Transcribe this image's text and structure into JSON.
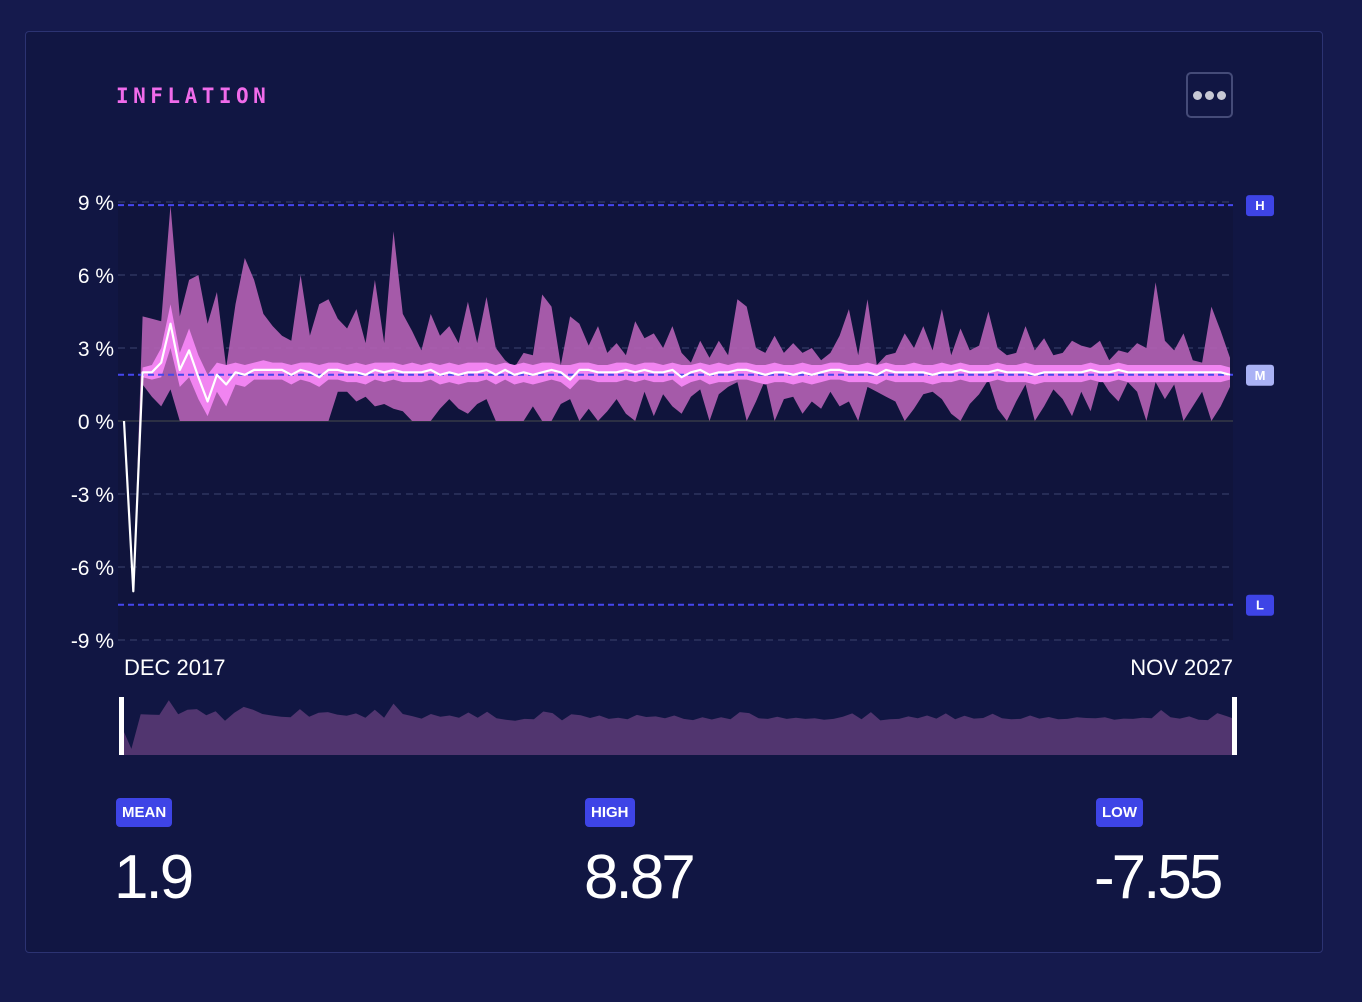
{
  "title": "INFLATION",
  "menu_icon": "ellipsis-icon",
  "colors": {
    "background": "#151a4d",
    "card": "#111643",
    "title": "#f06bea",
    "band_outer": "#b261b3",
    "band_inner": "#f184f1",
    "line": "#ffffff",
    "reference": "#4447ee",
    "badge": "#3e44e6",
    "navigator_fill": "#51356f"
  },
  "chart_data": {
    "type": "area",
    "yunit": " %",
    "ylim": [
      -9,
      9
    ],
    "yticks": [
      9,
      6,
      3,
      0,
      -3,
      -6,
      -9
    ],
    "ytick_labels": [
      "9 %",
      "6 %",
      "3 %",
      "0 %",
      "-3 %",
      "-6 %",
      "-9 %"
    ],
    "x_start_label": "DEC 2017",
    "x_end_label": "NOV 2027",
    "grid": true,
    "reference_lines": [
      {
        "label": "H",
        "value": 8.87
      },
      {
        "label": "M",
        "value": 1.9
      },
      {
        "label": "L",
        "value": -7.55
      }
    ],
    "series": [
      {
        "name": "mean",
        "values": [
          0,
          -7,
          2,
          2,
          2.4,
          4,
          2.1,
          2.9,
          1.8,
          0.8,
          1.9,
          1.5,
          2,
          1.9,
          2.1,
          2.1,
          2.1,
          2.1,
          1.9,
          2.1,
          2,
          1.8,
          2.1,
          2.1,
          2,
          2,
          1.9,
          2.1,
          2,
          2.1,
          2,
          2,
          2,
          2.1,
          1.9,
          2,
          1.9,
          2,
          2,
          2.1,
          1.9,
          2.1,
          1.9,
          2,
          1.9,
          2,
          2.1,
          2,
          1.7,
          2.1,
          2.1,
          2,
          2,
          2,
          2.1,
          2,
          2.1,
          2,
          2,
          2.1,
          1.8,
          2,
          2.1,
          1.9,
          2,
          2,
          2.1,
          2.1,
          2,
          1.9,
          2,
          2,
          1.9,
          2,
          1.9,
          2,
          2.1,
          2.1,
          2,
          2,
          2,
          1.9,
          2.1,
          2,
          2,
          2,
          2,
          1.9,
          2,
          2,
          2.1,
          2,
          2,
          2,
          2.1,
          2,
          2,
          2,
          1.9,
          2,
          2,
          2,
          2,
          2,
          2.1,
          2,
          2,
          2.1,
          2,
          2,
          2,
          2,
          2,
          2,
          2,
          2,
          2,
          2,
          2,
          1.9
        ]
      },
      {
        "name": "inner_upper",
        "values": [
          0,
          -7,
          2.2,
          2.3,
          3,
          4.8,
          2.8,
          3.8,
          2.7,
          1.9,
          2.4,
          2.3,
          2.4,
          2.3,
          2.4,
          2.5,
          2.4,
          2.4,
          2.3,
          2.4,
          2.4,
          2.3,
          2.4,
          2.4,
          2.3,
          2.4,
          2.3,
          2.4,
          2.4,
          2.4,
          2.3,
          2.4,
          2.3,
          2.4,
          2.3,
          2.4,
          2.3,
          2.4,
          2.4,
          2.4,
          2.3,
          2.4,
          2.3,
          2.4,
          2.3,
          2.4,
          2.4,
          2.3,
          2.3,
          2.4,
          2.4,
          2.3,
          2.3,
          2.4,
          2.4,
          2.3,
          2.4,
          2.4,
          2.3,
          2.4,
          2.3,
          2.3,
          2.4,
          2.3,
          2.4,
          2.3,
          2.4,
          2.4,
          2.3,
          2.3,
          2.4,
          2.3,
          2.3,
          2.4,
          2.3,
          2.3,
          2.4,
          2.4,
          2.3,
          2.3,
          2.4,
          2.3,
          2.4,
          2.3,
          2.3,
          2.4,
          2.3,
          2.3,
          2.4,
          2.3,
          2.4,
          2.3,
          2.3,
          2.3,
          2.4,
          2.3,
          2.3,
          2.4,
          2.3,
          2.3,
          2.3,
          2.3,
          2.3,
          2.3,
          2.4,
          2.3,
          2.3,
          2.4,
          2.3,
          2.3,
          2.3,
          2.3,
          2.3,
          2.3,
          2.3,
          2.3,
          2.3,
          2.3,
          2.3,
          2.2
        ]
      },
      {
        "name": "inner_lower",
        "values": [
          0,
          -7,
          1.8,
          1.7,
          1.8,
          3,
          1.4,
          1.8,
          0.9,
          0.2,
          1.2,
          0.6,
          1.5,
          1.4,
          1.7,
          1.7,
          1.7,
          1.7,
          1.5,
          1.7,
          1.6,
          1.4,
          1.7,
          1.7,
          1.6,
          1.6,
          1.5,
          1.7,
          1.6,
          1.7,
          1.6,
          1.6,
          1.6,
          1.7,
          1.5,
          1.6,
          1.5,
          1.6,
          1.6,
          1.7,
          1.5,
          1.7,
          1.5,
          1.6,
          1.5,
          1.6,
          1.7,
          1.6,
          1.3,
          1.7,
          1.7,
          1.6,
          1.6,
          1.6,
          1.7,
          1.6,
          1.7,
          1.6,
          1.6,
          1.7,
          1.4,
          1.6,
          1.7,
          1.5,
          1.6,
          1.6,
          1.7,
          1.7,
          1.6,
          1.5,
          1.6,
          1.6,
          1.5,
          1.6,
          1.5,
          1.6,
          1.7,
          1.7,
          1.6,
          1.6,
          1.6,
          1.5,
          1.7,
          1.6,
          1.6,
          1.6,
          1.6,
          1.5,
          1.6,
          1.6,
          1.7,
          1.6,
          1.6,
          1.6,
          1.7,
          1.6,
          1.6,
          1.6,
          1.5,
          1.6,
          1.6,
          1.6,
          1.6,
          1.6,
          1.7,
          1.6,
          1.6,
          1.7,
          1.6,
          1.6,
          1.6,
          1.6,
          1.6,
          1.6,
          1.6,
          1.6,
          1.6,
          1.6,
          1.6,
          1.7
        ]
      },
      {
        "name": "outer_upper",
        "values": [
          0,
          -7,
          4.3,
          4.2,
          4.1,
          8.87,
          4.3,
          5.8,
          6,
          4,
          5.3,
          2.2,
          4.8,
          6.7,
          5.8,
          4.4,
          3.9,
          3.5,
          3.3,
          6,
          3.5,
          4.8,
          5,
          4.2,
          3.8,
          4.6,
          3.2,
          5.8,
          3.2,
          7.8,
          4.4,
          3.7,
          2.9,
          4.4,
          3.5,
          3.9,
          3.2,
          4.9,
          3.2,
          5.1,
          3,
          2.5,
          2.2,
          2.8,
          2.7,
          5.2,
          4.7,
          2.3,
          4.3,
          4,
          3.1,
          3.9,
          2.8,
          3.2,
          2.7,
          4.1,
          3.4,
          3.6,
          3,
          3.9,
          2.8,
          2.4,
          3.3,
          2.6,
          3.3,
          2.7,
          5,
          4.7,
          3,
          2.8,
          3.5,
          2.8,
          3.2,
          2.8,
          3,
          2.5,
          2.8,
          3.5,
          4.6,
          2.7,
          5,
          2.3,
          2.7,
          2.8,
          3.6,
          3,
          3.9,
          2.9,
          4.6,
          2.7,
          3.8,
          2.9,
          3.1,
          4.5,
          3,
          2.7,
          2.8,
          3.9,
          2.9,
          3.4,
          2.7,
          2.8,
          3.3,
          3.1,
          3,
          3.3,
          2.5,
          2.9,
          2.8,
          3.2,
          3,
          5.7,
          3.3,
          2.9,
          3.6,
          2.5,
          2.4,
          4.7,
          3.7,
          2.6
        ]
      },
      {
        "name": "outer_lower",
        "values": [
          0,
          -7,
          1.5,
          1,
          0.6,
          1.3,
          0,
          0,
          0,
          0,
          0,
          0,
          0,
          0,
          0,
          0,
          0,
          0,
          0,
          0,
          0,
          0,
          0,
          1.2,
          1.2,
          0.8,
          1,
          0.6,
          0.7,
          0.5,
          0.4,
          0,
          0,
          0,
          0.5,
          0.9,
          0.5,
          0.3,
          0.7,
          0.9,
          0,
          0,
          0,
          0,
          0.6,
          0,
          0,
          0.7,
          0.9,
          0,
          0.5,
          0,
          0.4,
          0.9,
          0.3,
          0,
          1.2,
          0.2,
          1.1,
          0.6,
          0.3,
          1,
          1.3,
          0,
          1.1,
          1.4,
          1.6,
          0,
          0.8,
          1.7,
          0,
          0.9,
          1,
          0.3,
          0.8,
          0.5,
          1.2,
          0.6,
          0.8,
          0,
          1.4,
          1.2,
          1,
          0.8,
          0,
          0.5,
          1.1,
          1.2,
          0.9,
          0.3,
          0,
          0.7,
          1.1,
          1.7,
          0.5,
          0,
          0.8,
          1.5,
          0,
          0.6,
          1.3,
          0.9,
          0.2,
          1.2,
          0.4,
          1.8,
          1.2,
          0.8,
          1.6,
          1.2,
          0,
          1.6,
          0.9,
          1.5,
          0,
          0.6,
          1.2,
          0,
          0.6,
          1.4
        ]
      }
    ]
  },
  "stats": [
    {
      "label": "MEAN",
      "value": "1.9"
    },
    {
      "label": "HIGH",
      "value": "8.87"
    },
    {
      "label": "LOW",
      "value": "-7.55"
    }
  ]
}
